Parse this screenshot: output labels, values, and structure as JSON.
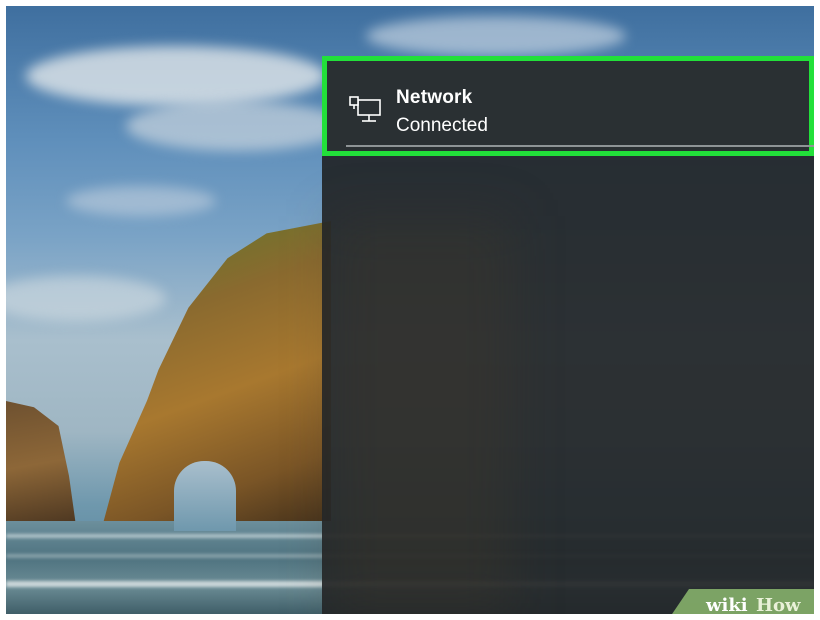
{
  "network_tile": {
    "title": "Network",
    "status": "Connected",
    "icon": "wired-network-icon",
    "highlight_color": "#22e03a"
  },
  "watermark": {
    "part1": "wiki",
    "part2": "How"
  }
}
